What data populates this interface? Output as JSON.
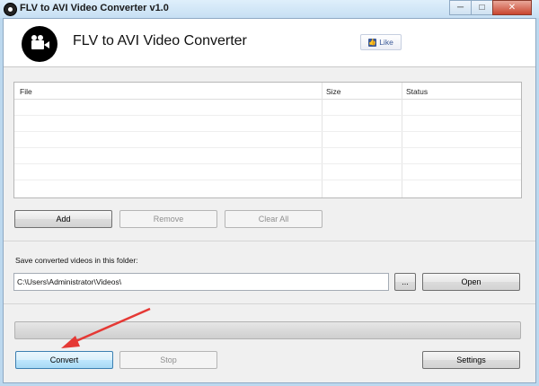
{
  "window": {
    "title": "FLV to AVI Video Converter v1.0",
    "controls": [
      "─",
      "□",
      "✕"
    ]
  },
  "header": {
    "app_title": "FLV to AVI Video Converter",
    "logo_icon": "video-camera-icon",
    "like_label": "Like",
    "like_icon": "thumbs-up-icon"
  },
  "file_table": {
    "columns": [
      "File",
      "Size",
      "Status"
    ],
    "rows": []
  },
  "actions": {
    "add_label": "Add",
    "remove_label": "Remove",
    "clear_all_label": "Clear All"
  },
  "output": {
    "label": "Save converted videos in this folder:",
    "folder_path": "C:\\Users\\Administrator\\Videos\\",
    "browse_label": "...",
    "open_label": "Open"
  },
  "progress": {
    "value": 0
  },
  "bottom": {
    "convert_label": "Convert",
    "stop_label": "Stop",
    "settings_label": "Settings"
  },
  "colors": {
    "annotation_arrow": "#e53935",
    "focus_border": "#3c7fb1"
  }
}
